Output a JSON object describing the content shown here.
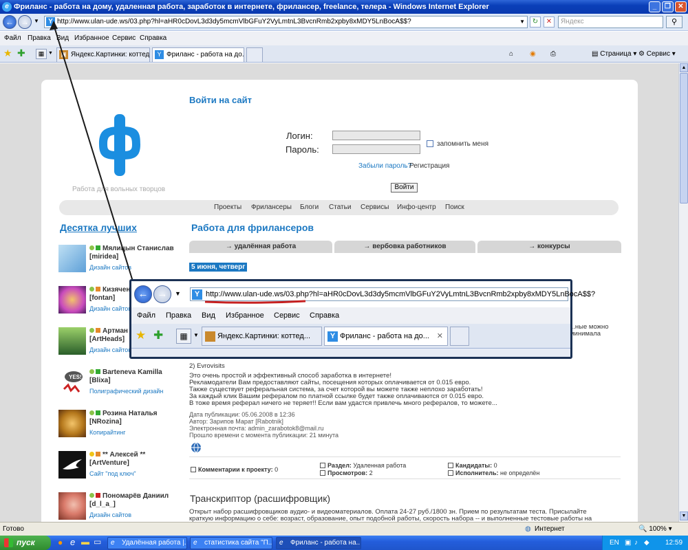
{
  "window": {
    "title": "Фриланс - работа на дому, удаленная работа, заработок в интернете, фрилансер, freelance, телера - Windows Internet Explorer"
  },
  "address": {
    "url": "http://www.ulan-ude.ws/03.php?hl=aHR0cDovL3d3dy5mcmVlbGFuY2VyLmtnL3BvcnRmb2xpby8xMDY5LnBocA==",
    "url_short": "http://www.ulan-ude.ws/03.php?hl=aHR0cDovL3d3dy5mcmVlbGFuY2VyLmtnL3BvcnRmb2xpby8xMDY5LnBocA$$?",
    "search_placeholder": "Яндекс"
  },
  "menu": [
    "Файл",
    "Правка",
    "Вид",
    "Избранное",
    "Сервис",
    "Справка"
  ],
  "tabs": [
    {
      "label": "Яндекс.Картинки: коттед..."
    },
    {
      "label": "Фриланс - работа на до..."
    }
  ],
  "toolbar": {
    "page": "Страница",
    "service": "Сервис"
  },
  "site": {
    "tagline": "Работа для вольных творцов",
    "login_title": "Войти на сайт",
    "login_label": "Логин:",
    "password_label": "Пароль:",
    "remember": "запомнить меня",
    "forgot": "Забыли пароль?",
    "register": "Регистрация",
    "login_button": "Войти",
    "nav": [
      "Проекты",
      "Фрилансеры",
      "Блоги",
      "Статьи",
      "Сервисы",
      "Инфо-центр",
      "Поиск"
    ],
    "top10_title": "Десятка лучших",
    "work_title": "Работа для фрилансеров",
    "pills": [
      "удалённая работа",
      "вербовка работников",
      "конкурсы"
    ],
    "date": "5 июня, четверг"
  },
  "users": [
    {
      "name": "Мялицын Станислав",
      "nick": "[miridea]",
      "category": "Дизайн сайтов",
      "color": "#5ea0d8"
    },
    {
      "name": "Кизяченко",
      "nick": "[fontan]",
      "category": "Дизайн сайтов",
      "color": "#c94bbd"
    },
    {
      "name": "Артман",
      "nick": "[ArtHeads]",
      "category": "Дизайн сайтов",
      "color": "#3a7e3a"
    },
    {
      "name": "Barteneva Kamilla",
      "nick": "[Blixa]",
      "category": "Полиграфический дизайн",
      "color": "#c22"
    },
    {
      "name": "Розина Наталья",
      "nick": "[NRozina]",
      "category": "Копирайтинг",
      "color": "#b5781c"
    },
    {
      "name": "** Алексей **",
      "nick": "[ArtVenture]",
      "category": "Сайт \"под ключ\"",
      "color": "#111"
    },
    {
      "name": "Пономарёв Даниил",
      "nick": "[d_l_a_]",
      "category": "Дизайн сайтов",
      "color": "#d97a6a"
    }
  ],
  "post": {
    "snippet_right": "...ные можно",
    "snippet_right2": "минимала",
    "title": "2) Evrovisits",
    "lines": [
      "Это очень простой и эффективный способ заработка в интернете!",
      "Рекламодатели Вам предоставляют сайты, посещения которых оплачивается от 0.015 евро.",
      "Также существует реферальная система, за счет которой вы можете также неплохо заработать!",
      "За каждый клик Вашим рефералом по платной ссылке будет также оплачиваются от 0.015 евро.",
      "В тоже время реферал ничего не теряет!! Если вам удастся привлечь много рефералов, то можете..."
    ],
    "meta": [
      "Дата публикации: 05.06.2008 в 12:36",
      "Автор: Зарипов Марат [Rabotnik]",
      "Электронная почта: admin_zarabotok8@mail.ru",
      "Прошло времени с момента публикации: 21 минута"
    ],
    "comments_label": "Комментарии к проекту:",
    "comments": "0",
    "section_label": "Раздел:",
    "section": "Удаленная работа",
    "views_label": "Просмотров:",
    "views": "2",
    "candidates_label": "Кандидаты:",
    "candidates": "0",
    "executor_label": "Исполнитель:",
    "executor": "не определён"
  },
  "post2": {
    "title": "Транскриптор (расшифровщик)",
    "lines": [
      "Открыт набор расшифровщиков аудио- и видеоматериалов. Оплата 24-27 руб./1800 зн. Прием по результатам теста. Присылайте",
      "краткую информацию о себе: возраст, образование, опыт подобной работы, скорость набора -- и выполненные тестовые работы на"
    ]
  },
  "zoom": {
    "url": "http://www.ulan-ude.ws/03.php?hl=aHR0cDovL3d3dy5mcmVlbGFuY2VyLmtnL3BvcnRmb2xpby8xMDY5LnBocA$$?"
  },
  "status": {
    "left": "Готово",
    "zone": "Интернет",
    "zoom": "100%"
  },
  "taskbar": {
    "start": "пуск",
    "items": [
      "Удалённая работа |...",
      "статистика сайта \"П...",
      "Фриланс - работа на..."
    ],
    "lang": "EN",
    "time": "12:59"
  }
}
